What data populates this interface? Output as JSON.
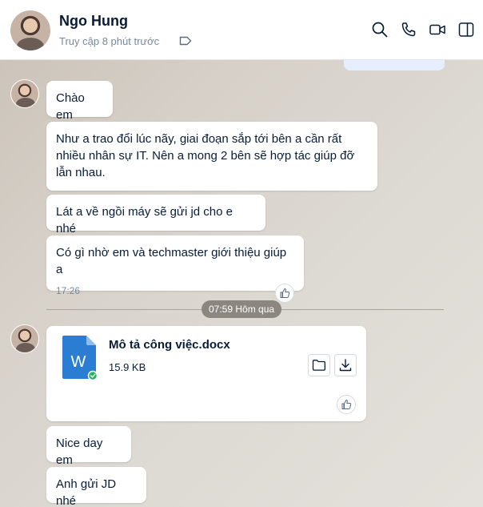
{
  "header": {
    "name": "Ngo Hung",
    "status": "Truy cập 8 phút trước"
  },
  "messages": [
    {
      "text": "Chào em"
    },
    {
      "text": "Như a trao đổi lúc nãy, giai đoạn sắp tới bên a cần rất nhiều nhân sự IT. Nên a mong 2 bên sẽ hợp tác giúp đỡ lẫn nhau."
    },
    {
      "text": "Lát a về ngồi máy sẽ gửi jd cho e nhé"
    },
    {
      "text": "Có gì nhờ em và techmaster giới thiệu giúp a",
      "time": "17:26"
    }
  ],
  "divider": {
    "label": "07:59 Hôm qua"
  },
  "file": {
    "name": "Mô tả công việc.docx",
    "size": "15.9 KB",
    "icon_letter": "W"
  },
  "messages2": [
    {
      "text": "Nice day em"
    },
    {
      "text": "Anh gửi JD nhé"
    }
  ],
  "icons": {
    "search": "search-icon",
    "call": "phone-icon",
    "video": "video-icon",
    "sidebar": "sidebar-toggle-icon",
    "tag": "tag-icon",
    "like": "thumbs-up-icon",
    "folder": "folder-icon",
    "download": "download-icon"
  },
  "colors": {
    "header_bg": "#ffffff",
    "bubble_bg": "#ffffff",
    "word_blue": "#2b7cd3",
    "check_green": "#27b35a",
    "status_gray": "#7589a3"
  }
}
